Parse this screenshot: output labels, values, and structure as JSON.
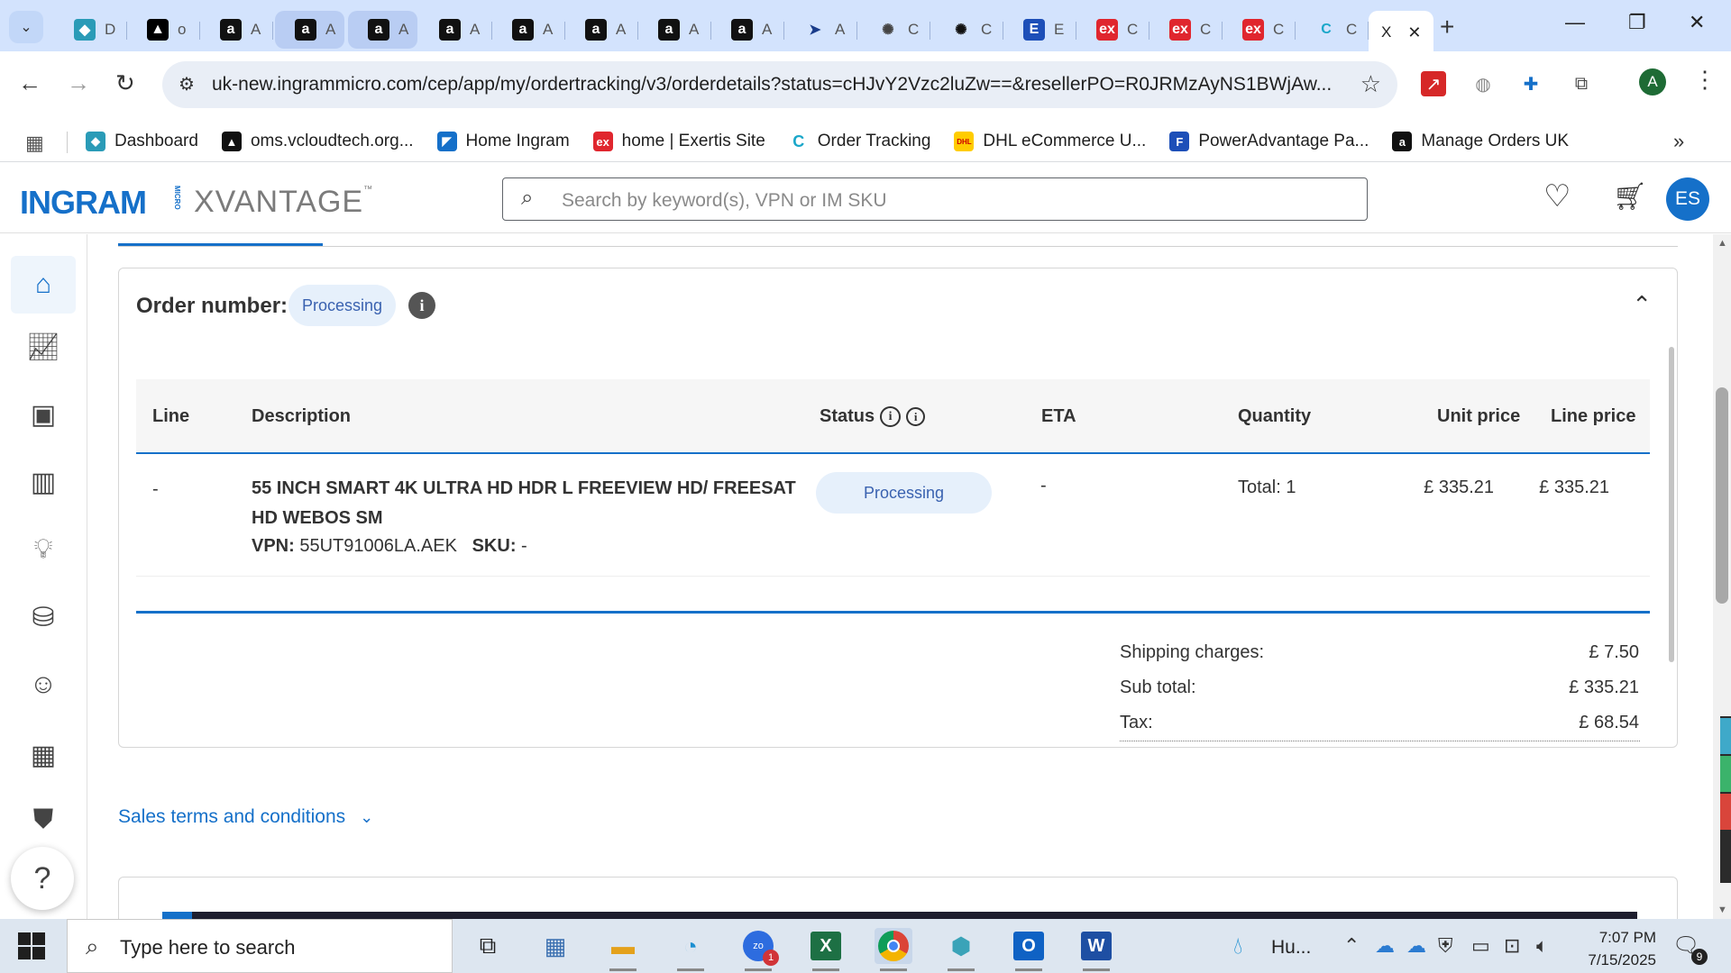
{
  "browser": {
    "tabs": [
      {
        "letter": "D",
        "icon": "dashboard-icon",
        "color": "#2a9bb7"
      },
      {
        "letter": "o",
        "icon": "vcloud-icon",
        "color": "#000000"
      },
      {
        "letter": "A",
        "icon": "amazon-icon",
        "color": "#111111"
      },
      {
        "letter": "A",
        "icon": "amazon-icon",
        "color": "#111111"
      },
      {
        "letter": "A",
        "icon": "amazon-icon",
        "color": "#111111"
      },
      {
        "letter": "A",
        "icon": "amazon-icon",
        "color": "#111111"
      },
      {
        "letter": "A",
        "icon": "amazon-icon",
        "color": "#111111"
      },
      {
        "letter": "A",
        "icon": "amazon-icon",
        "color": "#111111"
      },
      {
        "letter": "A",
        "icon": "amazon-icon",
        "color": "#111111"
      },
      {
        "letter": "A",
        "icon": "amazon-icon",
        "color": "#111111"
      },
      {
        "letter": "A",
        "icon": "arrow-icon",
        "color": "#1a3c8a"
      },
      {
        "letter": "C",
        "icon": "openai-icon",
        "color": "#444444"
      },
      {
        "letter": "C",
        "icon": "openai-icon",
        "color": "#111111"
      },
      {
        "letter": "E",
        "icon": "e-icon",
        "color": "#1d4fb8"
      },
      {
        "letter": "C",
        "icon": "exertis-icon",
        "color": "#e0262e"
      },
      {
        "letter": "C",
        "icon": "exertis-icon",
        "color": "#e0262e"
      },
      {
        "letter": "C",
        "icon": "exertis-icon",
        "color": "#e0262e"
      },
      {
        "letter": "C",
        "icon": "ingram-c-icon",
        "color": "#1aa7c9"
      }
    ],
    "active_tab": {
      "letter": "X"
    },
    "address": "uk-new.ingrammicro.com/cep/app/my/ordertracking/v3/orderdetails?status=cHJvY2Vzc2luZw==&resellerPO=R0JRMzAyNS1BWjAw...",
    "profile_initial": "A",
    "bookmarks": [
      {
        "label": "Dashboard",
        "icon": "dashboard-icon",
        "color": "#2a9bb7"
      },
      {
        "label": "oms.vcloudtech.org...",
        "icon": "vcloud-icon",
        "color": "#111111"
      },
      {
        "label": "Home Ingram",
        "icon": "ingram-icon",
        "color": "#1570c9"
      },
      {
        "label": "home | Exertis Site",
        "icon": "exertis-icon",
        "color": "#e0262e"
      },
      {
        "label": "Order Tracking",
        "icon": "ingram-c-icon",
        "color": "#1aa7c9"
      },
      {
        "label": "DHL eCommerce U...",
        "icon": "dhl-icon",
        "color": "#ffcc00"
      },
      {
        "label": "PowerAdvantage Pa...",
        "icon": "poweradvantage-icon",
        "color": "#1d4fb8"
      },
      {
        "label": "Manage Orders UK",
        "icon": "amazon-icon",
        "color": "#111111"
      }
    ]
  },
  "header": {
    "logo_ingram": "INGRAM",
    "logo_micro": "MICRO",
    "logo_xvantage": "XVANTAGE",
    "logo_tm": "™",
    "search_placeholder": "Search by keyword(s), VPN or IM SKU",
    "avatar_initials": "ES"
  },
  "order": {
    "label": "Order number:",
    "status_chip": "Processing",
    "table": {
      "headers": {
        "line": "Line",
        "description": "Description",
        "status": "Status",
        "eta": "ETA",
        "quantity": "Quantity",
        "unit_price": "Unit price",
        "line_price": "Line price"
      },
      "rows": [
        {
          "line": "-",
          "description": "55 INCH SMART 4K ULTRA HD HDR L FREEVIEW HD/ FREESAT HD WEBOS SM",
          "vpn_label": "VPN:",
          "vpn": "55UT91006LA.AEK",
          "sku_label": "SKU:",
          "sku": "-",
          "status": "Processing",
          "eta": "-",
          "quantity": "Total: 1",
          "unit_price": "£ 335.21",
          "line_price": "£ 335.21"
        }
      ]
    },
    "summary": {
      "shipping_label": "Shipping charges:",
      "shipping_value": "£ 7.50",
      "subtotal_label": "Sub total:",
      "subtotal_value": "£ 335.21",
      "tax_label": "Tax:",
      "tax_value": "£ 68.54"
    }
  },
  "terms_link": "Sales terms and conditions",
  "taskbar": {
    "search_text": "Type here to search",
    "weather_text": "Hu...",
    "zoom_badge": "1",
    "time": "7:07 PM",
    "date": "7/15/2025",
    "notification_count": "9"
  },
  "colors": {
    "accent": "#1570c9",
    "chip_bg": "#e6f0fb",
    "chip_text": "#3a62b0",
    "tabstrip": "#d3e3fd"
  }
}
